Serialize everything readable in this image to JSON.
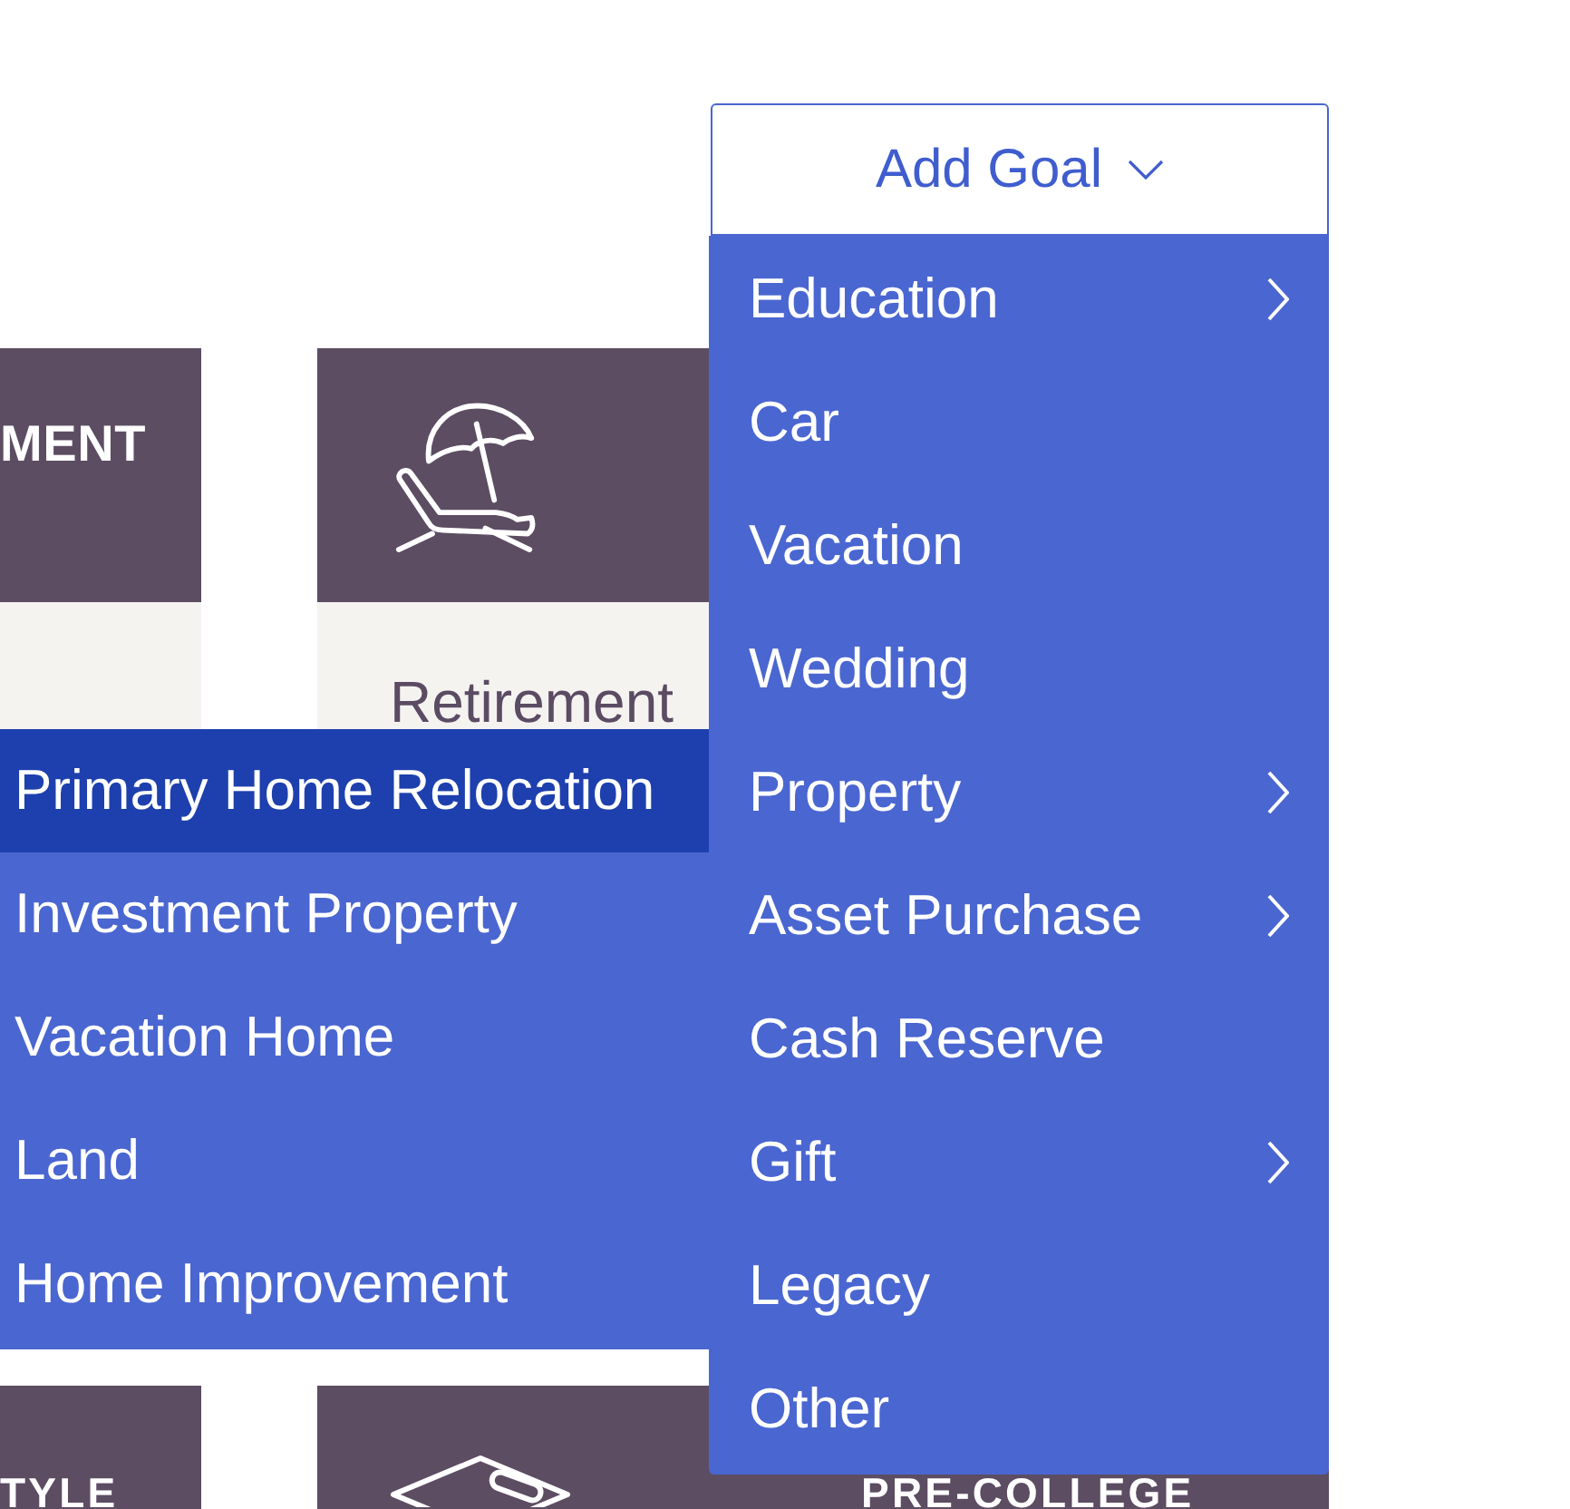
{
  "cards": [
    {
      "kind": "plain",
      "title": "MENT"
    },
    {
      "kind": "vacation",
      "body": "Retirement"
    },
    {
      "kind": "plain",
      "title": "TYLE"
    },
    {
      "kind": "education",
      "title": "PRE-COLLEGE"
    }
  ],
  "add_goal": {
    "label": "Add Goal",
    "items": [
      {
        "label": "Education",
        "has_submenu": true,
        "selected": false
      },
      {
        "label": "Car",
        "has_submenu": false,
        "selected": false
      },
      {
        "label": "Vacation",
        "has_submenu": false,
        "selected": false
      },
      {
        "label": "Wedding",
        "has_submenu": false,
        "selected": false
      },
      {
        "label": "Property",
        "has_submenu": true,
        "selected": false,
        "submenu": [
          {
            "label": "Primary Home Relocation",
            "selected": true
          },
          {
            "label": "Investment Property",
            "selected": false
          },
          {
            "label": "Vacation Home",
            "selected": false
          },
          {
            "label": "Land",
            "selected": false
          },
          {
            "label": "Home Improvement",
            "selected": false
          }
        ]
      },
      {
        "label": "Asset Purchase",
        "has_submenu": true,
        "selected": false
      },
      {
        "label": "Cash Reserve",
        "has_submenu": false,
        "selected": false
      },
      {
        "label": "Gift",
        "has_submenu": true,
        "selected": false
      },
      {
        "label": "Legacy",
        "has_submenu": false,
        "selected": false
      },
      {
        "label": "Other",
        "has_submenu": false,
        "selected": false
      }
    ]
  }
}
